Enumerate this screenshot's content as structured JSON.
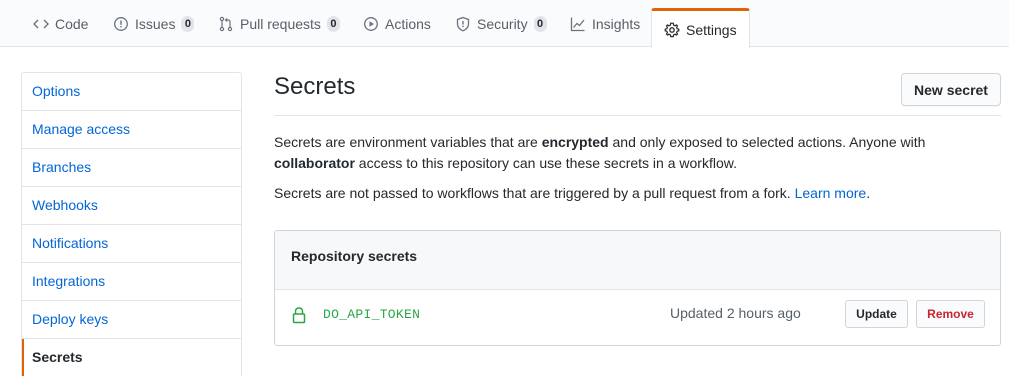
{
  "tabs": [
    {
      "label": "Code",
      "icon": "code-icon"
    },
    {
      "label": "Issues",
      "count": "0",
      "icon": "issue-opened-icon"
    },
    {
      "label": "Pull requests",
      "count": "0",
      "icon": "git-pull-request-icon"
    },
    {
      "label": "Actions",
      "icon": "play-icon"
    },
    {
      "label": "Security",
      "count": "0",
      "icon": "shield-icon"
    },
    {
      "label": "Insights",
      "icon": "graph-icon"
    },
    {
      "label": "Settings",
      "icon": "gear-icon",
      "selected": true
    }
  ],
  "sidebar": {
    "items": [
      {
        "label": "Options"
      },
      {
        "label": "Manage access"
      },
      {
        "label": "Branches"
      },
      {
        "label": "Webhooks"
      },
      {
        "label": "Notifications"
      },
      {
        "label": "Integrations"
      },
      {
        "label": "Deploy keys"
      },
      {
        "label": "Secrets",
        "selected": true
      }
    ]
  },
  "main": {
    "title": "Secrets",
    "new_secret_label": "New secret",
    "para1": {
      "t1": "Secrets are environment variables that are ",
      "b1": "encrypted",
      "t2": " and only exposed to selected actions. Anyone with ",
      "b2": "collaborator",
      "t3": " access to this repository can use these secrets in a workflow."
    },
    "para2": {
      "text": "Secrets are not passed to workflows that are triggered by a pull request from a fork. ",
      "link": "Learn more",
      "end": "."
    },
    "repo_secrets": {
      "header": "Repository secrets",
      "items": [
        {
          "name": "DO_API_TOKEN",
          "updated": "Updated 2 hours ago",
          "update_label": "Update",
          "remove_label": "Remove",
          "icon": "lock-icon"
        }
      ]
    }
  },
  "colors": {
    "accent": "#e36209",
    "link": "#0366d6",
    "secret_name": "#28a745",
    "danger": "#cb2431"
  }
}
